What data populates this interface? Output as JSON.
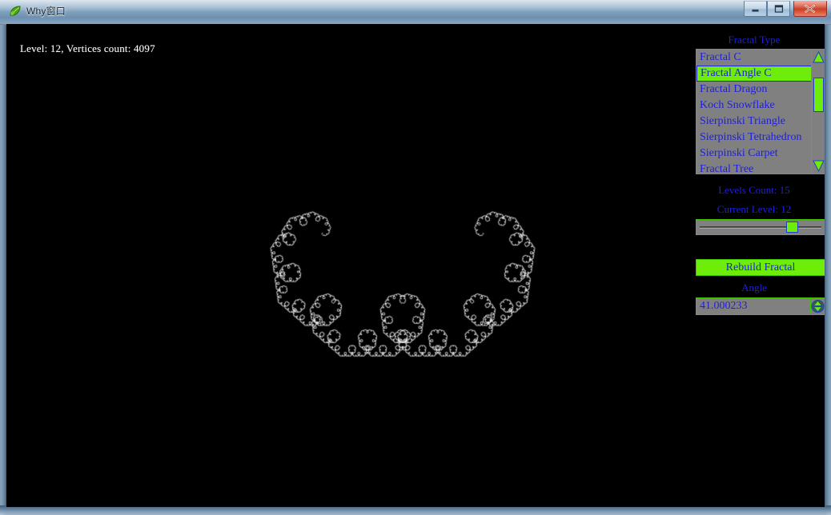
{
  "window": {
    "title": "Why窗口",
    "app_icon": "leaf-icon",
    "caption_buttons": [
      {
        "name": "minimize",
        "glyph": "minimize-icon"
      },
      {
        "name": "maximize",
        "glyph": "maximize-icon"
      },
      {
        "name": "close",
        "glyph": "close-icon"
      }
    ]
  },
  "canvas": {
    "background": "#000000",
    "stroke": "#ffffff",
    "status_text": "Level: 12, Vertices count: 4097"
  },
  "panel": {
    "label_fractal_type": "Fractal Type",
    "label_levels_count": "Levels Count: 15",
    "label_current_level": "Current Level: 12",
    "label_angle": "Angle",
    "rebuild_button": "Rebuild Fractal",
    "angle_value": "41.000233",
    "text_color": "#2020d8",
    "accent_green": "#6eec0a",
    "list_background": "#808080"
  },
  "fractal_list": {
    "selected_index": 1,
    "items": [
      {
        "label": "Fractal C"
      },
      {
        "label": "Fractal Angle C"
      },
      {
        "label": "Fractal Dragon"
      },
      {
        "label": "Koch Snowflake"
      },
      {
        "label": "Sierpinski Triangle"
      },
      {
        "label": "Sierpinski Tetrahedron"
      },
      {
        "label": "Sierpinski Carpet"
      },
      {
        "label": "Fractal Tree"
      }
    ]
  },
  "slider": {
    "min": 1,
    "max": 15,
    "value": 12,
    "thumb_color": "#6eec0a"
  },
  "scrollbar": {
    "up_arrow": "triangle-up-icon",
    "down_arrow": "triangle-down-icon",
    "thumb_position_pct": 14,
    "thumb_size_pct": 36
  },
  "fractal_render": {
    "type": "levy-angle-c-curve",
    "level": 12,
    "angle_degrees": 41.000233,
    "vertices_count": 4097,
    "stroke_width": 0.85,
    "stroke_color": "#f2f2f2"
  }
}
